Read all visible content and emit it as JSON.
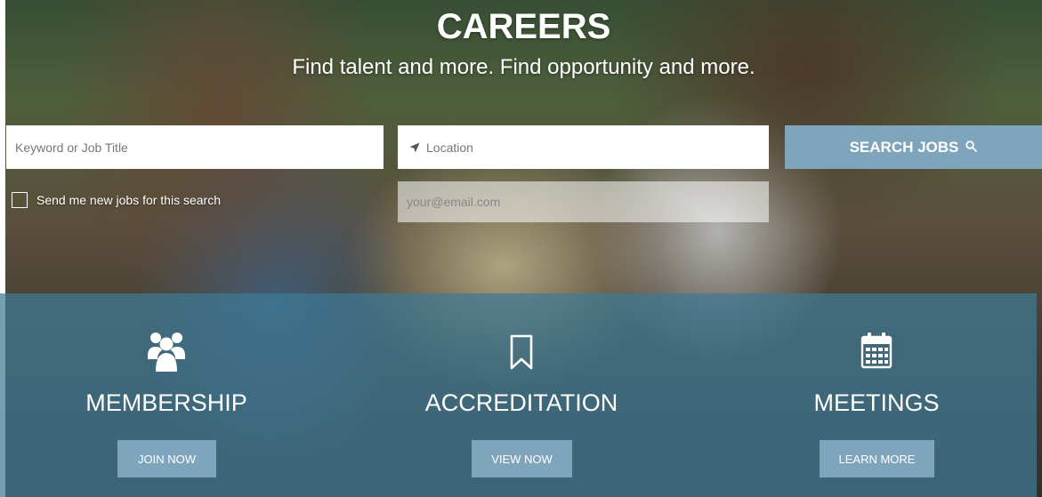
{
  "header": {
    "title": "CAREERS",
    "subtitle": "Find talent and more. Find opportunity and more."
  },
  "search": {
    "keyword_placeholder": "Keyword or Job Title",
    "location_placeholder": "Location",
    "button_label": "SEARCH JOBS",
    "button_icon": "search-icon",
    "location_icon": "location-arrow-icon"
  },
  "job_alert": {
    "checkbox_label": "Send me new jobs for this search",
    "checked": false,
    "email_placeholder": "your@email.com"
  },
  "features": [
    {
      "icon": "users-icon",
      "title": "MEMBERSHIP",
      "button_label": "JOIN NOW"
    },
    {
      "icon": "bookmark-icon",
      "title": "ACCREDITATION",
      "button_label": "VIEW NOW"
    },
    {
      "icon": "calendar-icon",
      "title": "MEETINGS",
      "button_label": "LEARN MORE"
    }
  ],
  "colors": {
    "accent_button": "#7fa5bd",
    "band_overlay": "#3e7a96",
    "text_light": "#ffffff"
  }
}
